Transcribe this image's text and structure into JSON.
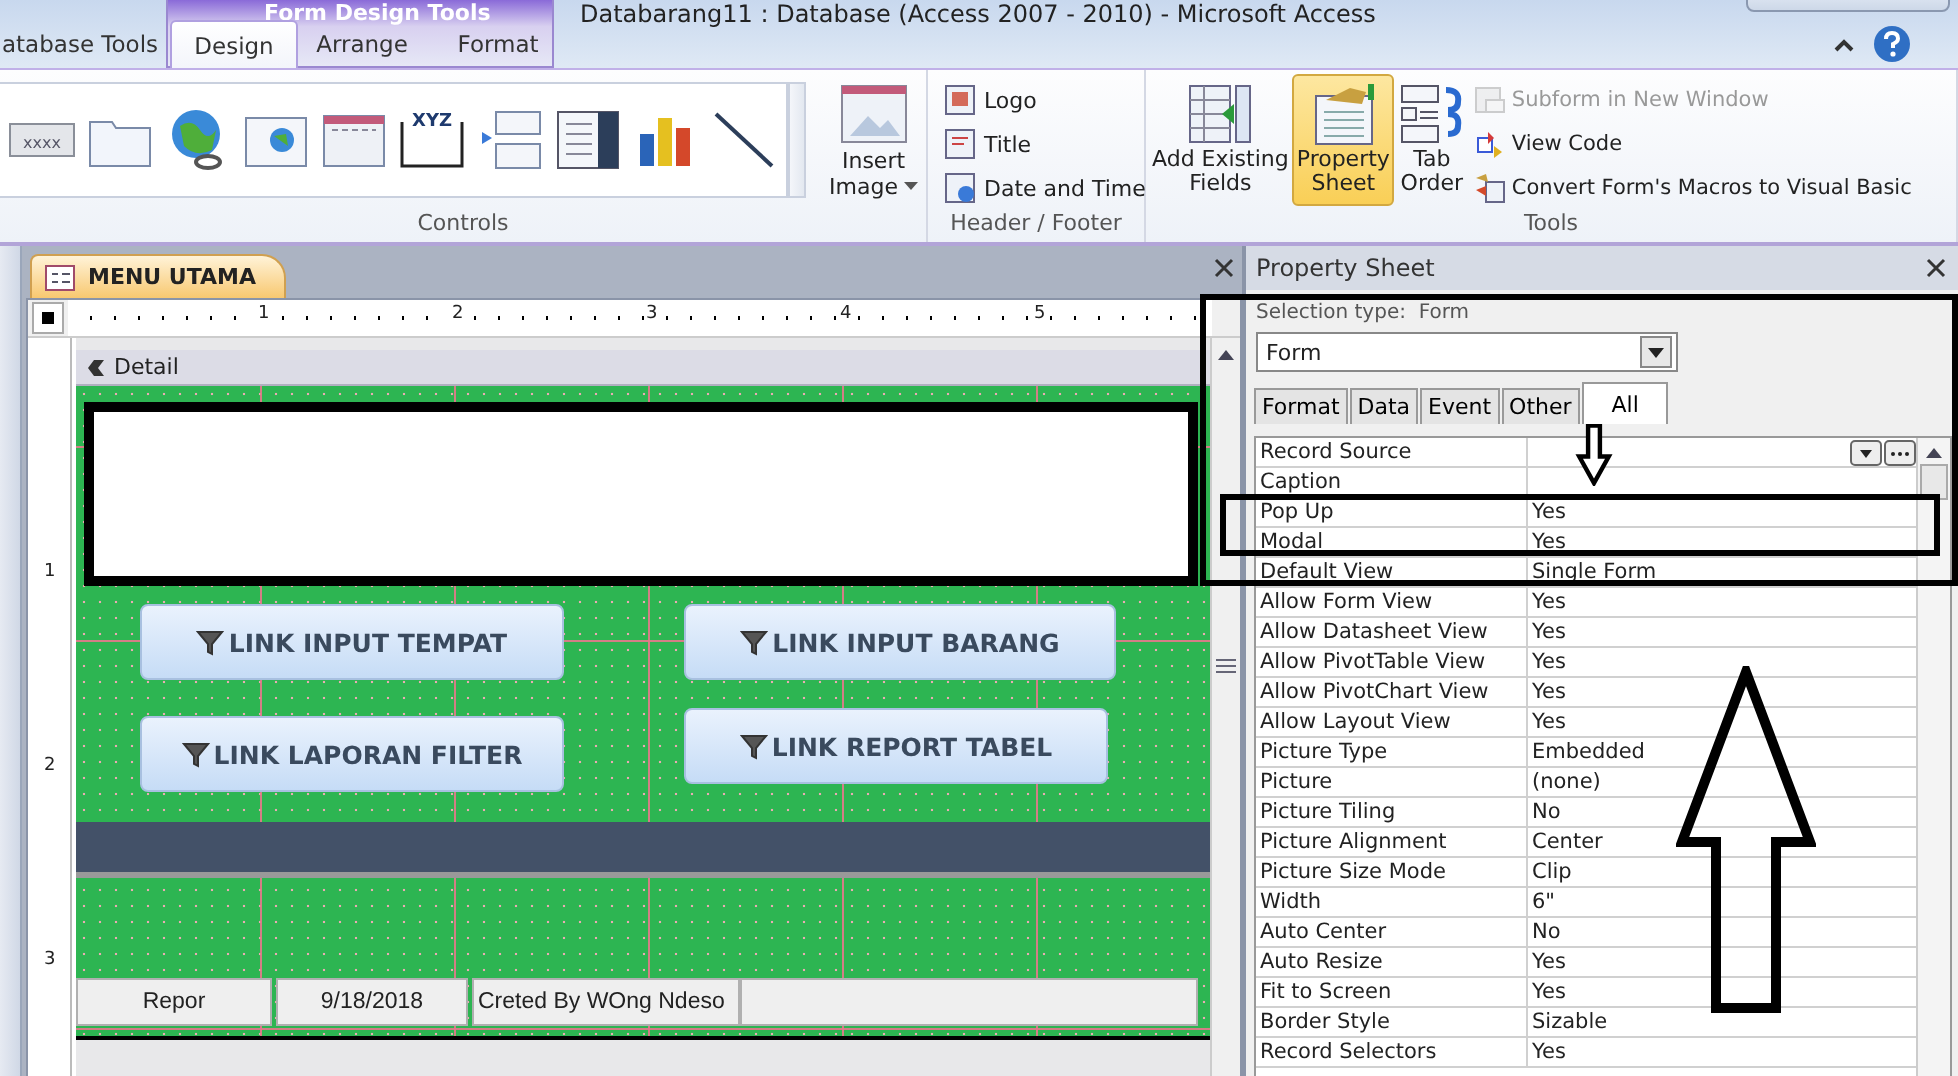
{
  "window": {
    "title": "Databarang11 : Database (Access 2007 - 2010) - Microsoft Access"
  },
  "ribbon": {
    "context_group": "Form Design Tools",
    "tabs": [
      {
        "label": "atabase Tools",
        "selected": false
      },
      {
        "label": "Design",
        "selected": true
      },
      {
        "label": "Arrange",
        "selected": false
      },
      {
        "label": "Format",
        "selected": false
      }
    ],
    "controls": {
      "label": "Controls",
      "gallery": [
        {
          "kind": "button",
          "text": "xxxx"
        },
        {
          "kind": "tab"
        },
        {
          "kind": "hyperlink"
        },
        {
          "kind": "web"
        },
        {
          "kind": "navigation"
        },
        {
          "kind": "frame",
          "text": "XYZ"
        },
        {
          "kind": "pagebreak"
        },
        {
          "kind": "listbox"
        },
        {
          "kind": "chart"
        },
        {
          "kind": "line"
        }
      ],
      "insert_image": [
        "Insert",
        "Image"
      ]
    },
    "header_footer": {
      "label": "Header / Footer",
      "items": [
        {
          "kind": "logo",
          "label": "Logo"
        },
        {
          "kind": "title",
          "label": "Title"
        },
        {
          "kind": "date",
          "label": "Date and Time"
        }
      ]
    },
    "tools": {
      "label": "Tools",
      "big_buttons": [
        {
          "kind": "fields",
          "lines": [
            "Add Existing",
            "Fields"
          ],
          "selected": false
        },
        {
          "kind": "sheet",
          "lines": [
            "Property",
            "Sheet"
          ],
          "selected": true
        },
        {
          "kind": "order",
          "lines": [
            "Tab",
            "Order"
          ],
          "selected": false
        }
      ],
      "items": [
        {
          "kind": "subform",
          "label": "Subform in New Window",
          "disabled": true
        },
        {
          "kind": "code",
          "label": "View Code",
          "disabled": false
        },
        {
          "kind": "macro",
          "label": "Convert Form's Macros to Visual Basic",
          "disabled": false
        }
      ]
    }
  },
  "document": {
    "tab": "MENU UTAMA",
    "ruler": [
      "1",
      "2",
      "3",
      "4",
      "5"
    ],
    "vruler": [
      "1",
      "2",
      "3"
    ],
    "section": "Detail",
    "buttons": [
      {
        "label": "LINK INPUT TEMPAT"
      },
      {
        "label": "LINK INPUT BARANG"
      },
      {
        "label": "LINK LAPORAN FILTER"
      },
      {
        "label": "LINK REPORT TABEL"
      }
    ],
    "footer_fields": [
      "Repor",
      "9/18/2018",
      "Creted By WOng Ndeso"
    ]
  },
  "property_sheet": {
    "title": "Property Sheet",
    "selection_label": "Selection type:",
    "selection_value": "Form",
    "dropdown": "Form",
    "tabs": [
      {
        "label": "Format",
        "selected": false
      },
      {
        "label": "Data",
        "selected": false
      },
      {
        "label": "Event",
        "selected": false
      },
      {
        "label": "Other",
        "selected": false
      },
      {
        "label": "All",
        "selected": true
      }
    ],
    "rows": [
      {
        "name": "Record Source",
        "kind": "builder"
      },
      {
        "name": "Caption"
      },
      {
        "name": "Pop Up",
        "value": "Yes"
      },
      {
        "name": "Modal",
        "value": "Yes"
      },
      {
        "name": "Default View",
        "value": "Single Form"
      },
      {
        "name": "Allow Form View",
        "value": "Yes"
      },
      {
        "name": "Allow Datasheet View",
        "value": "Yes"
      },
      {
        "name": "Allow PivotTable View",
        "value": "Yes"
      },
      {
        "name": "Allow PivotChart View",
        "value": "Yes"
      },
      {
        "name": "Allow Layout View",
        "value": "Yes"
      },
      {
        "name": "Picture Type",
        "value": "Embedded"
      },
      {
        "name": "Picture",
        "value": "(none)"
      },
      {
        "name": "Picture Tiling",
        "value": "No"
      },
      {
        "name": "Picture Alignment",
        "value": "Center"
      },
      {
        "name": "Picture Size Mode",
        "value": "Clip"
      },
      {
        "name": "Width",
        "value": "6\""
      },
      {
        "name": "Auto Center",
        "value": "No"
      },
      {
        "name": "Auto Resize",
        "value": "Yes"
      },
      {
        "name": "Fit to Screen",
        "value": "Yes"
      },
      {
        "name": "Border Style",
        "value": "Sizable"
      },
      {
        "name": "Record Selectors",
        "value": "Yes"
      }
    ]
  }
}
